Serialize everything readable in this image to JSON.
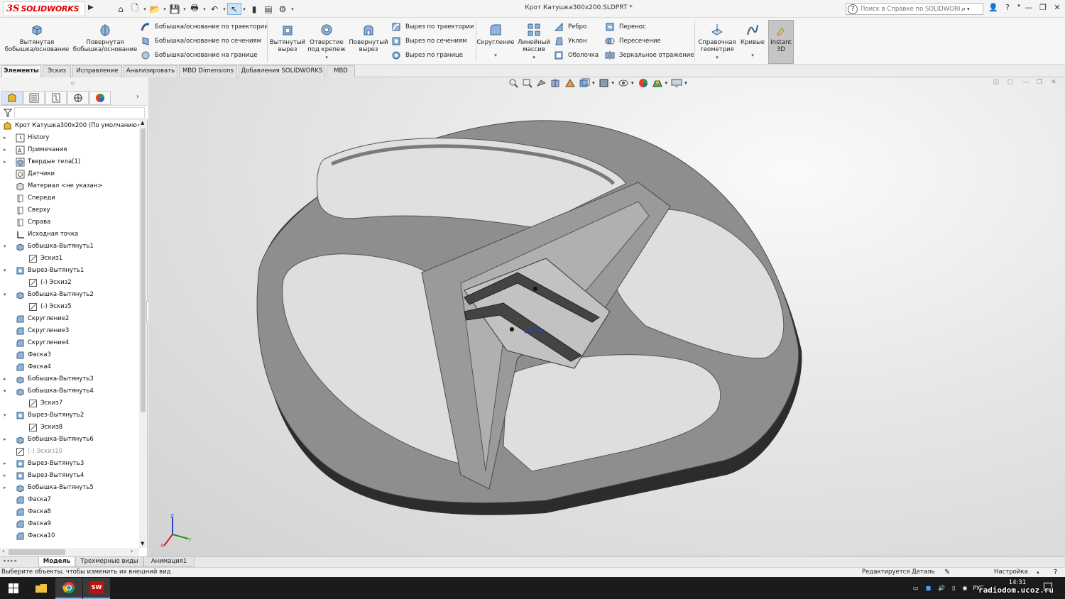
{
  "app": {
    "logo_ds": "3S",
    "logo_sw": "SOLIDWORKS",
    "doc_title": "Крот Катушка300x200.SLDPRT *",
    "help_placeholder": "Поиск в Справке по SOLIDWORKS"
  },
  "command_manager": {
    "extruded_boss": "Вытянутая бобышка/основание",
    "revolved_boss": "Повернутая бобышка/основание",
    "swept_boss": "Бобышка/основание по траектории",
    "lofted_boss": "Бобышка/основание по сечениям",
    "boundary_boss": "Бобышка/основание на границе",
    "extruded_cut": "Вытянутый вырез",
    "hole_wizard": "Отверстие под крепеж",
    "revolved_cut": "Повернутый вырез",
    "swept_cut": "Вырез по траектории",
    "lofted_cut": "Вырез по сечениям",
    "boundary_cut": "Вырез по границе",
    "fillet": "Скругление",
    "linear_pattern": "Линейный массив",
    "rib": "Ребро",
    "draft": "Уклон",
    "shell": "Оболочка",
    "wrap": "Перенос",
    "intersect": "Пересечение",
    "mirror": "Зеркальное отражение",
    "ref_geometry": "Справочная геометрия",
    "curves": "Кривые",
    "instant3d": "Instant 3D"
  },
  "tabs": [
    "Элементы",
    "Эскиз",
    "Исправление",
    "Анализировать",
    "MBD Dimensions",
    "Добавления SOLIDWORKS",
    "MBD"
  ],
  "tree": {
    "root": "Крот Катушка300x200  (По умолчанию<",
    "nodes": [
      {
        "label": "History",
        "indent": 0,
        "exp": "▸",
        "icon": "history-icon"
      },
      {
        "label": "Примечания",
        "indent": 0,
        "exp": "▸",
        "icon": "annotations-icon"
      },
      {
        "label": "Твердые тела(1)",
        "indent": 0,
        "exp": "▸",
        "icon": "solid-bodies-icon"
      },
      {
        "label": "Датчики",
        "indent": 0,
        "exp": "",
        "icon": "sensors-icon"
      },
      {
        "label": "Материал <не указан>",
        "indent": 0,
        "exp": "",
        "icon": "material-icon"
      },
      {
        "label": "Спереди",
        "indent": 0,
        "exp": "",
        "icon": "plane-icon"
      },
      {
        "label": "Сверху",
        "indent": 0,
        "exp": "",
        "icon": "plane-icon"
      },
      {
        "label": "Справа",
        "indent": 0,
        "exp": "",
        "icon": "plane-icon"
      },
      {
        "label": "Исходная точка",
        "indent": 0,
        "exp": "",
        "icon": "origin-icon"
      },
      {
        "label": "Бобышка-Вытянуть1",
        "indent": 0,
        "exp": "▾",
        "icon": "boss-extrude-icon"
      },
      {
        "label": "Эскиз1",
        "indent": 1,
        "exp": "",
        "icon": "sketch-icon"
      },
      {
        "label": "Вырез-Вытянуть1",
        "indent": 0,
        "exp": "▾",
        "icon": "cut-extrude-icon"
      },
      {
        "label": "(-) Эскиз2",
        "indent": 1,
        "exp": "",
        "icon": "sketch-icon"
      },
      {
        "label": "Бобышка-Вытянуть2",
        "indent": 0,
        "exp": "▾",
        "icon": "boss-extrude-icon"
      },
      {
        "label": "(-) Эскиз5",
        "indent": 1,
        "exp": "",
        "icon": "sketch-icon"
      },
      {
        "label": "Скругление2",
        "indent": 0,
        "exp": "",
        "icon": "fillet-icon"
      },
      {
        "label": "Скругление3",
        "indent": 0,
        "exp": "",
        "icon": "fillet-icon"
      },
      {
        "label": "Скругление4",
        "indent": 0,
        "exp": "",
        "icon": "fillet-icon"
      },
      {
        "label": "Фаска3",
        "indent": 0,
        "exp": "",
        "icon": "chamfer-icon"
      },
      {
        "label": "Фаска4",
        "indent": 0,
        "exp": "",
        "icon": "chamfer-icon"
      },
      {
        "label": "Бобышка-Вытянуть3",
        "indent": 0,
        "exp": "▸",
        "icon": "boss-extrude-icon"
      },
      {
        "label": "Бобышка-Вытянуть4",
        "indent": 0,
        "exp": "▾",
        "icon": "boss-extrude-icon"
      },
      {
        "label": "Эскиз7",
        "indent": 1,
        "exp": "",
        "icon": "sketch-icon"
      },
      {
        "label": "Вырез-Вытянуть2",
        "indent": 0,
        "exp": "▾",
        "icon": "cut-extrude-icon"
      },
      {
        "label": "Эскиз8",
        "indent": 1,
        "exp": "",
        "icon": "sketch-icon"
      },
      {
        "label": "Бобышка-Вытянуть6",
        "indent": 0,
        "exp": "▸",
        "icon": "boss-extrude-icon"
      },
      {
        "label": "(-) Эскиз10",
        "indent": 0,
        "exp": "",
        "icon": "sketch-icon",
        "dim": true
      },
      {
        "label": "Вырез-Вытянуть3",
        "indent": 0,
        "exp": "▸",
        "icon": "cut-extrude-icon"
      },
      {
        "label": "Вырез-Вытянуть4",
        "indent": 0,
        "exp": "▸",
        "icon": "cut-extrude-icon"
      },
      {
        "label": "Бобышка-Вытянуть5",
        "indent": 0,
        "exp": "▸",
        "icon": "boss-extrude-icon"
      },
      {
        "label": "Фаска7",
        "indent": 0,
        "exp": "",
        "icon": "chamfer-icon"
      },
      {
        "label": "Фаска8",
        "indent": 0,
        "exp": "",
        "icon": "chamfer-icon"
      },
      {
        "label": "Фаска9",
        "indent": 0,
        "exp": "",
        "icon": "chamfer-icon"
      },
      {
        "label": "Фаска10",
        "indent": 0,
        "exp": "",
        "icon": "chamfer-icon"
      }
    ]
  },
  "bottom_tabs": [
    "Модель",
    "Трехмерные виды",
    "Анимация1"
  ],
  "status": {
    "hint": "Выберите объекты, чтобы изменить их внешний вид",
    "mode": "Редактируется Деталь",
    "custom": "Настройка"
  },
  "taskbar": {
    "lang": "РУС",
    "time": "14:31"
  },
  "watermark": "radiodom.ucoz.ru",
  "colors": {
    "accent": "#d00000",
    "model_face": "#8e8e8e",
    "model_side": "#3a3a3a"
  }
}
